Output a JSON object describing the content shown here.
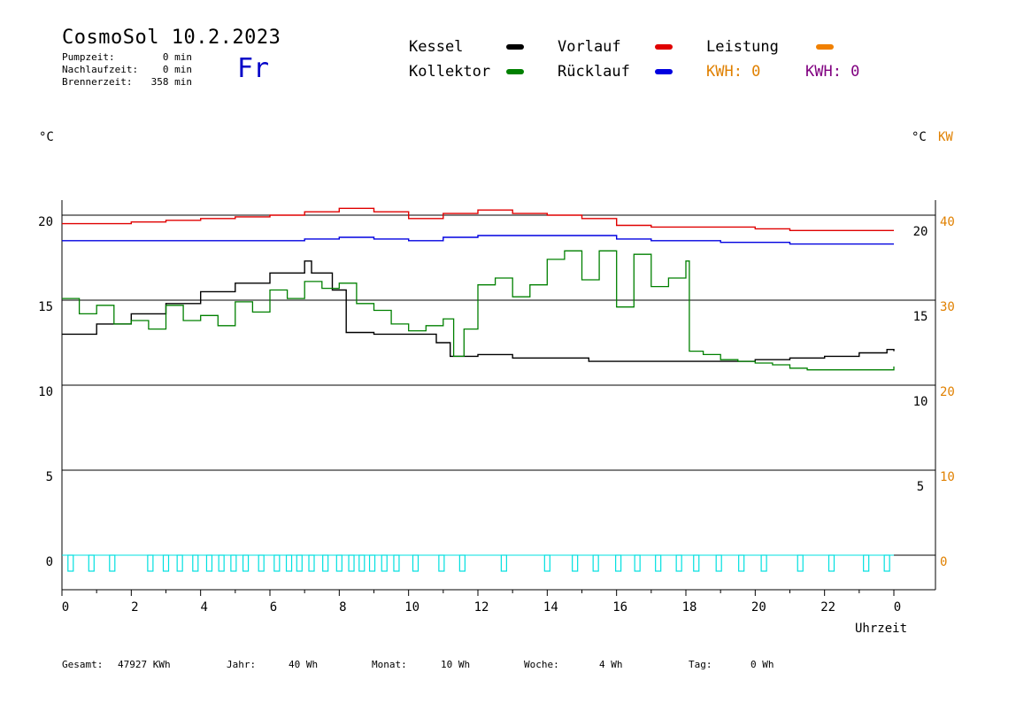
{
  "header": {
    "title": "CosmoSol 10.2.2023",
    "day": "Fr",
    "stats": [
      {
        "label": "Pumpzeit:",
        "value": "0 min"
      },
      {
        "label": "Nachlaufzeit:",
        "value": "0 min"
      },
      {
        "label": "Brennerzeit:",
        "value": "358 min"
      }
    ]
  },
  "legend": {
    "kessel": {
      "label": "Kessel",
      "color": "#000000"
    },
    "kollektor": {
      "label": "Kollektor",
      "color": "#008000"
    },
    "vorlauf": {
      "label": "Vorlauf",
      "color": "#e00000"
    },
    "ruecklauf": {
      "label": "Rücklauf",
      "color": "#0000e0"
    },
    "leistung": {
      "label": "Leistung",
      "color": "#f08000"
    },
    "kwh1": {
      "label": "KWH: 0",
      "color": "#e08000"
    },
    "kwh2": {
      "label": "KWH: 0",
      "color": "#800080"
    }
  },
  "axes": {
    "left_unit": "°C",
    "right_unit_c": "°C",
    "right_unit_kw": "KW",
    "xlabel": "Uhrzeit"
  },
  "footer": {
    "gesamt_label": "Gesamt:",
    "gesamt_value": "47927 KWh",
    "jahr_label": "Jahr:",
    "jahr_value": "40 Wh",
    "monat_label": "Monat:",
    "monat_value": "10 Wh",
    "woche_label": "Woche:",
    "woche_value": "4 Wh",
    "tag_label": "Tag:",
    "tag_value": "0 Wh"
  },
  "chart_data": {
    "type": "line",
    "xlim": [
      0,
      24
    ],
    "ylim": [
      -2,
      21
    ],
    "x_ticks": [
      0,
      2,
      4,
      6,
      8,
      10,
      12,
      14,
      16,
      18,
      20,
      22,
      24
    ],
    "x_tick_labels": [
      "0",
      "2",
      "4",
      "6",
      "8",
      "10",
      "12",
      "14",
      "16",
      "18",
      "20",
      "22",
      "0"
    ],
    "y_left_ticks": [
      0,
      5,
      10,
      15,
      20
    ],
    "y_left_labels": [
      "0",
      "5",
      "10",
      "15",
      "20"
    ],
    "y_right_c_labels": [
      "5",
      "10",
      "15",
      "20"
    ],
    "y_right_c_values": [
      5,
      10,
      15,
      20
    ],
    "y_right_kw_labels": [
      "0",
      "10",
      "20",
      "30",
      "40"
    ],
    "y_right_kw_values": [
      0,
      5,
      10,
      15,
      20
    ],
    "series": [
      {
        "name": "Vorlauf",
        "color": "#e00000",
        "x": [
          0,
          1,
          2,
          3,
          4,
          5,
          6,
          7,
          8,
          9,
          10,
          11,
          12,
          13,
          14,
          15,
          16,
          17,
          18,
          19,
          20,
          21,
          22,
          23,
          24
        ],
        "y": [
          19.5,
          19.5,
          19.6,
          19.7,
          19.8,
          19.9,
          20.0,
          20.2,
          20.4,
          20.2,
          19.8,
          20.1,
          20.3,
          20.1,
          20.0,
          19.8,
          19.4,
          19.3,
          19.3,
          19.3,
          19.2,
          19.1,
          19.1,
          19.1,
          19.1
        ]
      },
      {
        "name": "Rücklauf",
        "color": "#0000e0",
        "x": [
          0,
          2,
          4,
          6,
          7,
          8,
          9,
          10,
          11,
          12,
          13,
          14,
          15,
          16,
          17,
          18,
          19,
          20,
          21,
          22,
          23,
          24
        ],
        "y": [
          18.5,
          18.5,
          18.5,
          18.5,
          18.6,
          18.7,
          18.6,
          18.5,
          18.7,
          18.8,
          18.8,
          18.8,
          18.8,
          18.6,
          18.5,
          18.5,
          18.4,
          18.4,
          18.3,
          18.3,
          18.3,
          18.3
        ]
      },
      {
        "name": "Kessel",
        "color": "#000000",
        "x": [
          0,
          1,
          2,
          3,
          4,
          5,
          6,
          7,
          7.2,
          7.8,
          8.2,
          9,
          10,
          10.8,
          11.2,
          11.5,
          12,
          12.5,
          13,
          14,
          14.8,
          15.2,
          16,
          17,
          18,
          19,
          20,
          21,
          22,
          23,
          23.8,
          24
        ],
        "y": [
          13.0,
          13.6,
          14.2,
          14.8,
          15.5,
          16.0,
          16.6,
          17.3,
          16.6,
          15.6,
          13.1,
          13.0,
          13.0,
          12.5,
          11.7,
          11.7,
          11.8,
          11.8,
          11.6,
          11.6,
          11.6,
          11.4,
          11.4,
          11.4,
          11.4,
          11.4,
          11.5,
          11.6,
          11.7,
          11.9,
          12.1,
          12.0
        ]
      },
      {
        "name": "Kollektor",
        "color": "#008000",
        "x": [
          0,
          0.5,
          1,
          1.5,
          2,
          2.5,
          3,
          3.5,
          4,
          4.5,
          5,
          5.5,
          6,
          6.5,
          7,
          7.5,
          8,
          8.5,
          9,
          9.5,
          10,
          10.5,
          11,
          11.3,
          11.6,
          12,
          12.5,
          13,
          13.5,
          14,
          14.5,
          15,
          15.5,
          16,
          16.5,
          17,
          17.5,
          18,
          18.1,
          18.5,
          19,
          19.5,
          20,
          20.5,
          21,
          21.5,
          22,
          22.5,
          23,
          23.5,
          24
        ],
        "y": [
          15.1,
          14.2,
          14.7,
          13.6,
          13.8,
          13.3,
          14.7,
          13.8,
          14.1,
          13.5,
          14.9,
          14.3,
          15.6,
          15.1,
          16.1,
          15.7,
          16.0,
          14.8,
          14.4,
          13.6,
          13.2,
          13.5,
          13.9,
          11.7,
          13.3,
          15.9,
          16.3,
          15.2,
          15.9,
          17.4,
          17.9,
          16.2,
          17.9,
          14.6,
          17.7,
          15.8,
          16.3,
          17.3,
          12.0,
          11.8,
          11.5,
          11.4,
          11.3,
          11.2,
          11.0,
          10.9,
          10.9,
          10.9,
          10.9,
          10.9,
          11.1
        ]
      },
      {
        "name": "Leistung",
        "color": "#00e0e0",
        "pulses_x": [
          0.25,
          0.85,
          1.45,
          2.55,
          3.0,
          3.4,
          3.85,
          4.25,
          4.6,
          4.95,
          5.3,
          5.75,
          6.2,
          6.55,
          6.85,
          7.2,
          7.6,
          8.0,
          8.35,
          8.65,
          8.95,
          9.3,
          9.65,
          10.2,
          10.95,
          11.55,
          12.75,
          14.0,
          14.8,
          15.4,
          16.05,
          16.6,
          17.2,
          17.8,
          18.3,
          18.95,
          19.6,
          20.25,
          21.3,
          22.2,
          23.2,
          23.8
        ]
      }
    ]
  }
}
